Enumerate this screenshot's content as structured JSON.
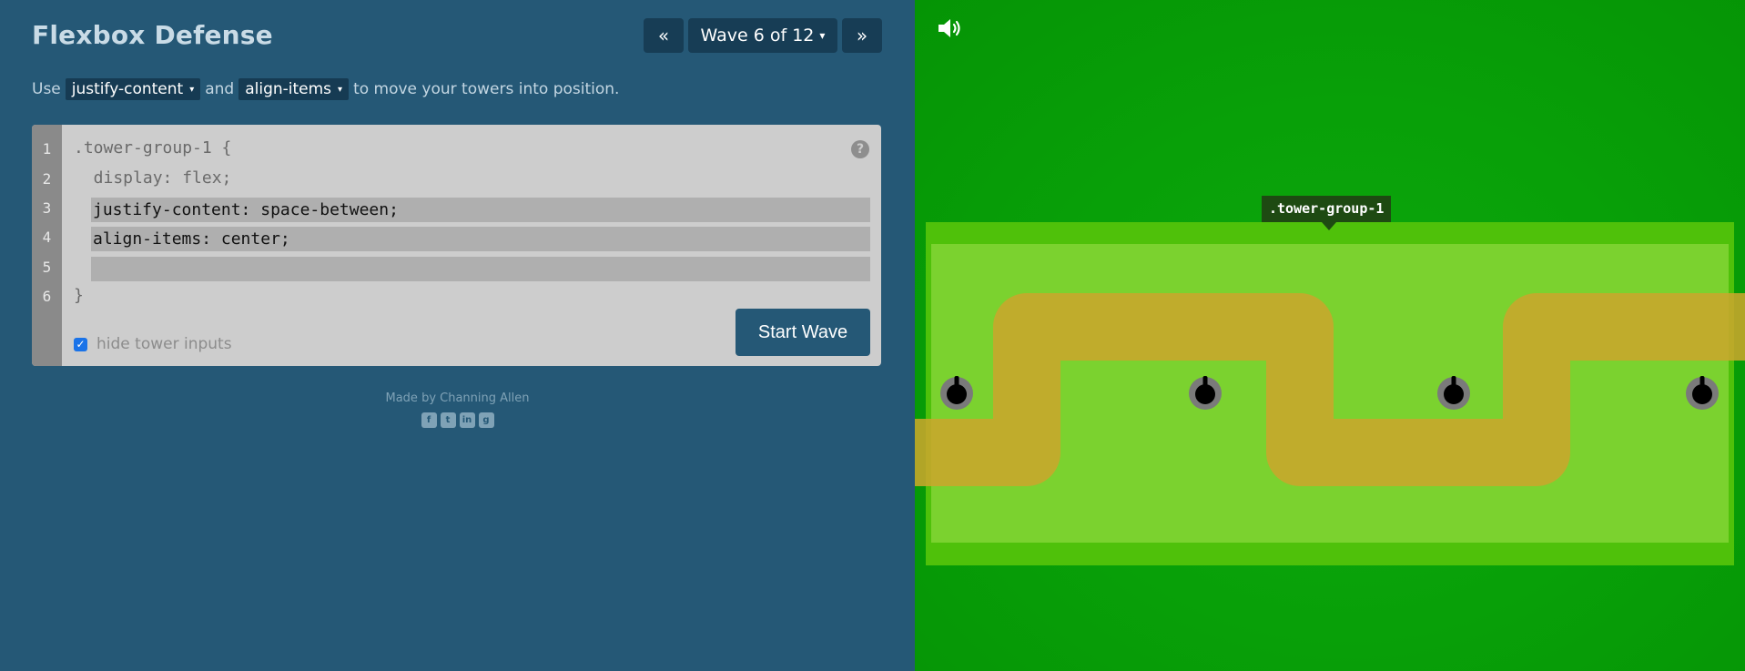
{
  "game": {
    "title": "Flexbox Defense",
    "wave_nav": {
      "prev_symbol": "«",
      "current": "Wave 6 of 12",
      "caret": "▾",
      "next_symbol": "»"
    },
    "instructions": {
      "prefix": "Use",
      "property_1": "justify-content",
      "connector": "and",
      "property_2": "align-items",
      "suffix": "to move your towers into position.",
      "dropdown_caret": "▾"
    }
  },
  "editor": {
    "line_numbers": [
      "1",
      "2",
      "3",
      "4",
      "5",
      "6"
    ],
    "line_1": ".tower-group-1 {",
    "line_2": "  display: flex;",
    "input_1": "justify-content: space-between;",
    "input_2": "align-items: center;",
    "input_3": "",
    "line_6": "}",
    "help_symbol": "?",
    "hide_inputs_label": "hide tower inputs",
    "hide_inputs_checked": true,
    "checkmark": "✓",
    "start_button": "Start Wave"
  },
  "footer": {
    "credit": "Made by Channing Allen",
    "social_icons": [
      {
        "name": "facebook-icon",
        "glyph": "f"
      },
      {
        "name": "twitter-icon",
        "glyph": "t"
      },
      {
        "name": "linkedin-icon",
        "glyph": "in"
      },
      {
        "name": "github-icon",
        "glyph": "g"
      }
    ]
  },
  "board": {
    "group_label": ".tower-group-1",
    "tower_count": 4,
    "justify_content": "space-between",
    "align_items": "center",
    "colors": {
      "panel": "#255876",
      "field": "#08a008",
      "group_outer": "#4fc10a",
      "group_inner": "#7bd22f",
      "path": "#c9a62c",
      "start_button": "#255876"
    }
  }
}
